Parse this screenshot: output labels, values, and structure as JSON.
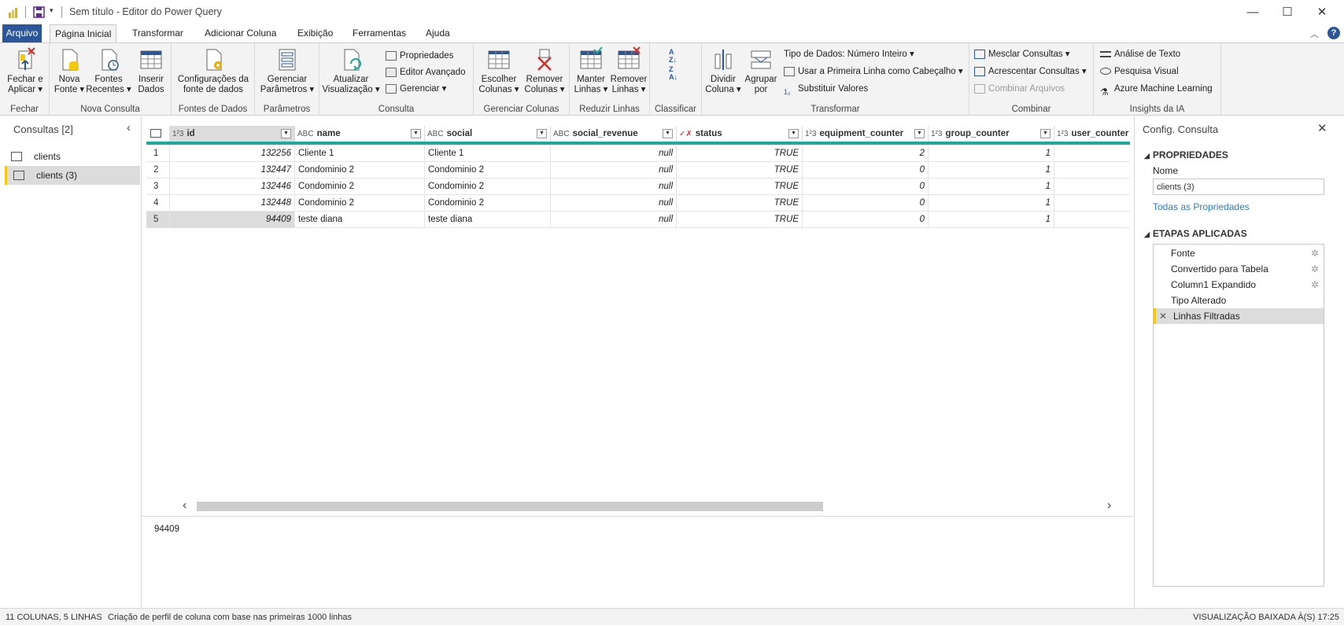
{
  "window": {
    "title": "Sem título - Editor do Power Query"
  },
  "tabs": [
    "Arquivo",
    "Página Inicial",
    "Transformar",
    "Adicionar Coluna",
    "Exibição",
    "Ferramentas",
    "Ajuda"
  ],
  "ribbon": {
    "fechar": {
      "line1": "Fechar e",
      "line2": "Aplicar ▾",
      "group": "Fechar"
    },
    "nova_fonte": {
      "line1": "Nova",
      "line2": "Fonte ▾"
    },
    "fontes_recentes": {
      "line1": "Fontes",
      "line2": "Recentes ▾"
    },
    "inserir_dados": {
      "line1": "Inserir",
      "line2": "Dados"
    },
    "nova_consulta_group": "Nova Consulta",
    "config_fonte": {
      "line1": "Configurações da",
      "line2": "fonte de dados",
      "group": "Fontes de Dados"
    },
    "gerenciar_param": {
      "line1": "Gerenciar",
      "line2": "Parâmetros ▾",
      "group": "Parâmetros"
    },
    "atualizar": {
      "line1": "Atualizar",
      "line2": "Visualização ▾"
    },
    "propriedades": "Propriedades",
    "editor_avancado": "Editor Avançado",
    "gerenciar": "Gerenciar ▾",
    "consulta_group": "Consulta",
    "escolher_colunas": {
      "line1": "Escolher",
      "line2": "Colunas ▾"
    },
    "remover_colunas": {
      "line1": "Remover",
      "line2": "Colunas ▾"
    },
    "gerenciar_colunas_group": "Gerenciar Colunas",
    "manter_linhas": {
      "line1": "Manter",
      "line2": "Linhas ▾"
    },
    "remover_linhas": {
      "line1": "Remover",
      "line2": "Linhas ▾"
    },
    "reduzir_linhas_group": "Reduzir Linhas",
    "classificar_group": "Classificar",
    "dividir_coluna": {
      "line1": "Dividir",
      "line2": "Coluna ▾"
    },
    "agrupar_por": {
      "line1": "Agrupar",
      "line2": "por"
    },
    "tipo_dados": "Tipo de Dados: Número Inteiro ▾",
    "primeira_linha": "Usar a Primeira Linha como Cabeçalho ▾",
    "substituir": "Substituir Valores",
    "transformar_group": "Transformar",
    "mesclar": "Mesclar Consultas ▾",
    "acrescentar": "Acrescentar Consultas ▾",
    "combinar_arquivos": "Combinar Arquivos",
    "combinar_group": "Combinar",
    "analise_texto": "Análise de Texto",
    "pesquisa_visual": "Pesquisa Visual",
    "azure_ml": "Azure Machine Learning",
    "insights_group": "Insights da IA"
  },
  "queries": {
    "header": "Consultas [2]",
    "items": [
      "clients",
      "clients (3)"
    ]
  },
  "table": {
    "columns": [
      {
        "type": "1²3",
        "name": "id"
      },
      {
        "type": "ABC",
        "name": "name"
      },
      {
        "type": "ABC",
        "name": "social"
      },
      {
        "type": "ABC",
        "name": "social_revenue"
      },
      {
        "type": "✓✗",
        "name": "status"
      },
      {
        "type": "1²3",
        "name": "equipment_counter"
      },
      {
        "type": "1²3",
        "name": "group_counter"
      },
      {
        "type": "1²3",
        "name": "user_counter"
      }
    ],
    "rows": [
      [
        "1",
        "132256",
        "Cliente 1",
        "Cliente 1",
        "null",
        "TRUE",
        "2",
        "1"
      ],
      [
        "2",
        "132447",
        "Condominio 2",
        "Condominio 2",
        "null",
        "TRUE",
        "0",
        "1"
      ],
      [
        "3",
        "132446",
        "Condominio 2",
        "Condominio 2",
        "null",
        "TRUE",
        "0",
        "1"
      ],
      [
        "4",
        "132448",
        "Condominio 2",
        "Condominio 2",
        "null",
        "TRUE",
        "0",
        "1"
      ],
      [
        "5",
        "94409",
        "teste diana",
        "teste diana",
        "null",
        "TRUE",
        "0",
        "1"
      ]
    ]
  },
  "detail_value": "94409",
  "settings": {
    "title": "Config. Consulta",
    "properties_header": "PROPRIEDADES",
    "name_label": "Nome",
    "name_value": "clients (3)",
    "all_props_link": "Todas as Propriedades",
    "steps_header": "ETAPAS APLICADAS",
    "steps": [
      "Fonte",
      "Convertido para Tabela",
      "Column1 Expandido",
      "Tipo Alterado",
      "Linhas Filtradas"
    ]
  },
  "status": {
    "left": "11 COLUNAS, 5 LINHAS",
    "profile": "Criação de perfil de coluna com base nas primeiras 1000 linhas",
    "right": "VISUALIZAÇÃO BAIXADA À(S) 17:25"
  },
  "colors": {
    "accent": "#2b579a",
    "teal": "#1fa99a",
    "yellow": "#f2c811"
  }
}
